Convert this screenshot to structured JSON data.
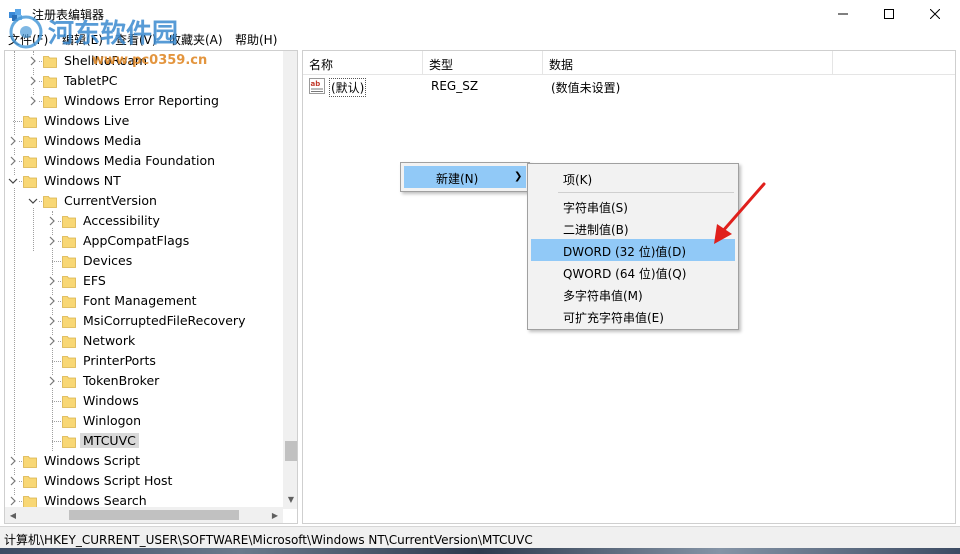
{
  "window": {
    "title": "注册表编辑器"
  },
  "watermark": {
    "brand": "河东软件园",
    "url": "www.pc0359.cn"
  },
  "menubar": {
    "items": [
      "文件(F)",
      "编辑(E)",
      "查看(V)",
      "收藏夹(A)",
      "帮助(H)"
    ]
  },
  "tree": {
    "items": [
      {
        "label": "ShellNoRoam",
        "level": 2,
        "expandable": true
      },
      {
        "label": "TabletPC",
        "level": 2,
        "expandable": true
      },
      {
        "label": "Windows Error Reporting",
        "level": 2,
        "expandable": true
      },
      {
        "label": "Windows Live",
        "level": 1,
        "expandable": false
      },
      {
        "label": "Windows Media",
        "level": 1,
        "expandable": true
      },
      {
        "label": "Windows Media Foundation",
        "level": 1,
        "expandable": true
      },
      {
        "label": "Windows NT",
        "level": 1,
        "expandable": "open"
      },
      {
        "label": "CurrentVersion",
        "level": 2,
        "expandable": "open"
      },
      {
        "label": "Accessibility",
        "level": 3,
        "expandable": true
      },
      {
        "label": "AppCompatFlags",
        "level": 3,
        "expandable": true
      },
      {
        "label": "Devices",
        "level": 3,
        "expandable": false
      },
      {
        "label": "EFS",
        "level": 3,
        "expandable": true
      },
      {
        "label": "Font Management",
        "level": 3,
        "expandable": true
      },
      {
        "label": "MsiCorruptedFileRecovery",
        "level": 3,
        "expandable": true
      },
      {
        "label": "Network",
        "level": 3,
        "expandable": true
      },
      {
        "label": "PrinterPorts",
        "level": 3,
        "expandable": false
      },
      {
        "label": "TokenBroker",
        "level": 3,
        "expandable": true
      },
      {
        "label": "Windows",
        "level": 3,
        "expandable": false
      },
      {
        "label": "Winlogon",
        "level": 3,
        "expandable": false
      },
      {
        "label": "MTCUVC",
        "level": 3,
        "expandable": false,
        "selected": true
      },
      {
        "label": "Windows Script",
        "level": 1,
        "expandable": true
      },
      {
        "label": "Windows Script Host",
        "level": 1,
        "expandable": true
      },
      {
        "label": "Windows Search",
        "level": 1,
        "expandable": true
      }
    ]
  },
  "list": {
    "columns": [
      "名称",
      "类型",
      "数据"
    ],
    "rows": [
      {
        "name": "(默认)",
        "type": "REG_SZ",
        "data": "(数值未设置)"
      }
    ]
  },
  "context_menu": {
    "new_label": "新建(N)",
    "submenu": {
      "key": "项(K)",
      "items": [
        "字符串值(S)",
        "二进制值(B)",
        "DWORD (32 位)值(D)",
        "QWORD (64 位)值(Q)",
        "多字符串值(M)",
        "可扩充字符串值(E)"
      ],
      "highlighted_index": 2
    }
  },
  "statusbar": {
    "path": "计算机\\HKEY_CURRENT_USER\\SOFTWARE\\Microsoft\\Windows NT\\CurrentVersion\\MTCUVC"
  },
  "colors": {
    "highlight": "#91c9f7",
    "folder": "#f8d775",
    "arrow": "#e0201c"
  }
}
